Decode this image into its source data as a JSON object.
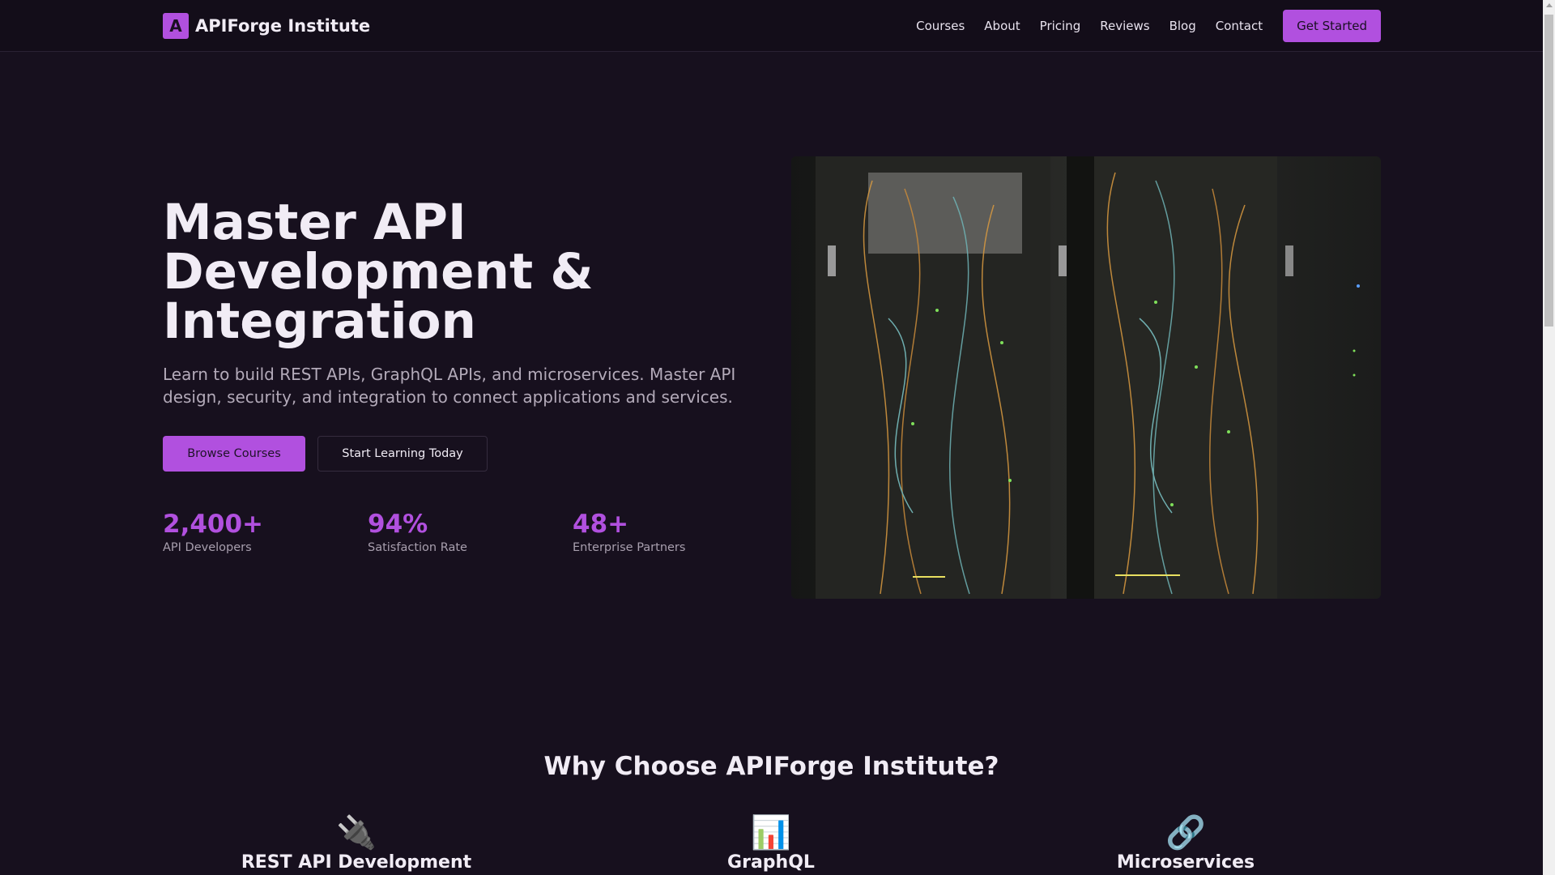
{
  "nav": {
    "logo_letter": "A",
    "brand": "APIForge Institute",
    "links": [
      "Courses",
      "About",
      "Pricing",
      "Reviews",
      "Blog",
      "Contact"
    ],
    "cta": "Get Started"
  },
  "hero": {
    "title": "Master API Development & Integration",
    "lead": "Learn to build REST APIs, GraphQL APIs, and microservices. Master API design, security, and integration to connect applications and services.",
    "primary_button": "Browse Courses",
    "secondary_button": "Start Learning Today",
    "stats": [
      {
        "value": "2,400+",
        "label": "API Developers"
      },
      {
        "value": "94%",
        "label": "Satisfaction Rate"
      },
      {
        "value": "48+",
        "label": "Enterprise Partners"
      }
    ]
  },
  "why": {
    "heading": "Why Choose APIForge Institute?",
    "features": [
      {
        "icon": "🔌",
        "title": "REST API Development"
      },
      {
        "icon": "📊",
        "title": "GraphQL"
      },
      {
        "icon": "🔗",
        "title": "Microservices"
      }
    ]
  },
  "colors": {
    "accent": "#b150df",
    "background": "#17101e"
  }
}
